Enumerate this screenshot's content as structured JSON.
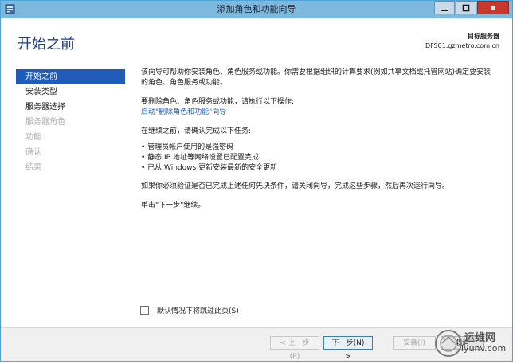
{
  "window": {
    "title": "添加角色和功能向导",
    "minimize_icon": "minimize-icon",
    "maximize_icon": "maximize-icon",
    "close_icon": "close-icon"
  },
  "header": {
    "page_title": "开始之前",
    "target_server_label": "目标服务器",
    "target_server_name": "DFS01.gzmetro.com.cn"
  },
  "nav": {
    "items": [
      {
        "label": "开始之前",
        "state": "active"
      },
      {
        "label": "安装类型",
        "state": "normal"
      },
      {
        "label": "服务器选择",
        "state": "normal"
      },
      {
        "label": "服务器角色",
        "state": "disabled"
      },
      {
        "label": "功能",
        "state": "disabled"
      },
      {
        "label": "确认",
        "state": "disabled"
      },
      {
        "label": "结果",
        "state": "disabled"
      }
    ]
  },
  "content": {
    "intro": "该向导可帮助你安装角色、角色服务或功能。你需要根据组织的计算要求(例如共享文档或托管网站)确定要安装的角色、角色服务或功能。",
    "remove_intro": "要删除角色、角色服务或功能，请执行以下操作:",
    "remove_link": "启动\"删除角色和功能\"向导",
    "before_continue": "在继续之前，请确认完成以下任务:",
    "bullets": [
      "• 管理员帐户使用的是强密码",
      "• 静态 IP 地址等网络设置已配置完成",
      "• 已从 Windows 更新安装最新的安全更新"
    ],
    "verify_note": "如果你必须验证是否已完成上述任何先决条件，请关闭向导，完成这些步骤，然后再次运行向导。",
    "click_next": "单击\"下一步\"继续。"
  },
  "skip_checkbox": {
    "label": "默认情况下将跳过此页(S)",
    "checked": false
  },
  "footer": {
    "prev_label": "< 上一步(P)",
    "next_label": "下一步(N) >",
    "install_label": "安装(I)",
    "cancel_label": "取消"
  },
  "watermark": {
    "text_top": "运维网",
    "text_bottom": "iyunv.com"
  },
  "colors": {
    "titlebar": "#7db8df",
    "accent": "#1f5bb8",
    "title_text": "#1f3f8b",
    "close_button": "#c7392e"
  }
}
